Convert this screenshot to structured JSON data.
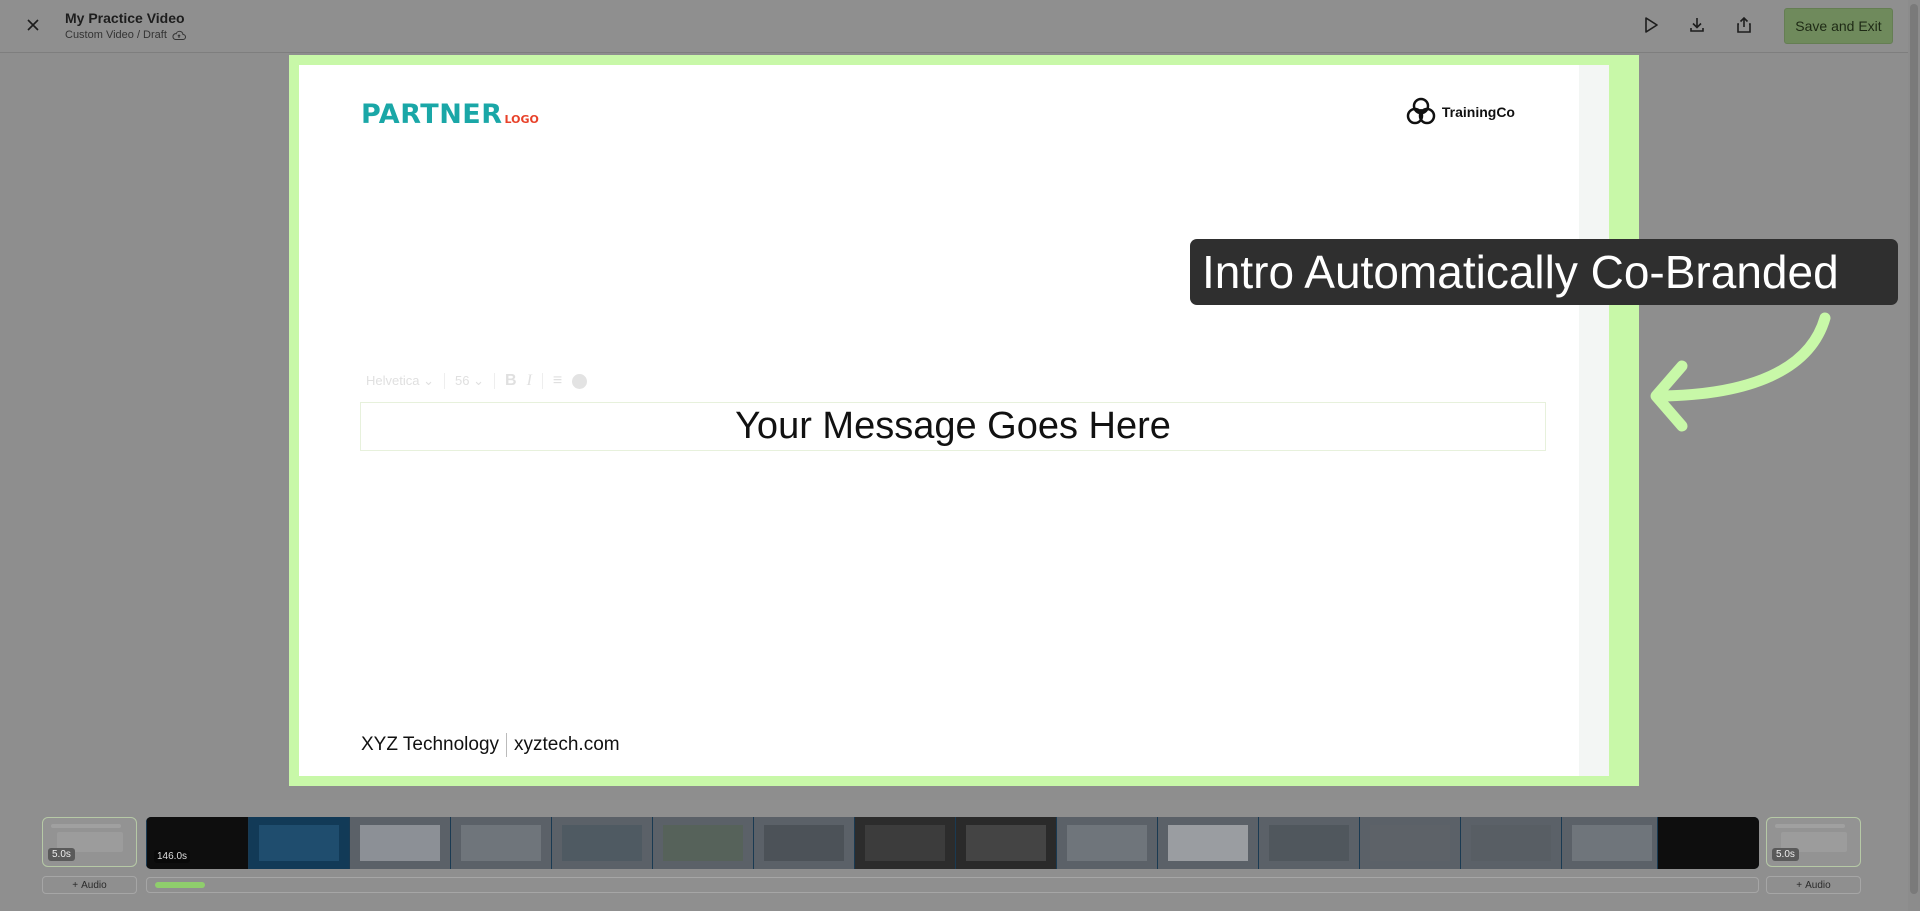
{
  "header": {
    "title": "My Practice Video",
    "subtitle": "Custom Video / Draft",
    "save_label": "Save and Exit"
  },
  "slide": {
    "partner_logo_main": "PARTNER",
    "partner_logo_sub": "LOGO",
    "brand_name": "TrainingCo",
    "toolbar": {
      "font": "Helvetica",
      "size": "56"
    },
    "message": "Your Message Goes Here",
    "footer_company": "XYZ Technology",
    "footer_url": "xyztech.com"
  },
  "callout": {
    "text": "Intro Automatically Co-Branded"
  },
  "timeline": {
    "left_card_duration": "5.0s",
    "strip_duration": "146.0s",
    "right_card_duration": "5.0s",
    "audio_label": "Audio"
  },
  "colors": {
    "accent": "#c8f8a8",
    "partner_teal": "#1aa7a7",
    "partner_red": "#e8422a",
    "save_button": "#6f8a5c"
  }
}
